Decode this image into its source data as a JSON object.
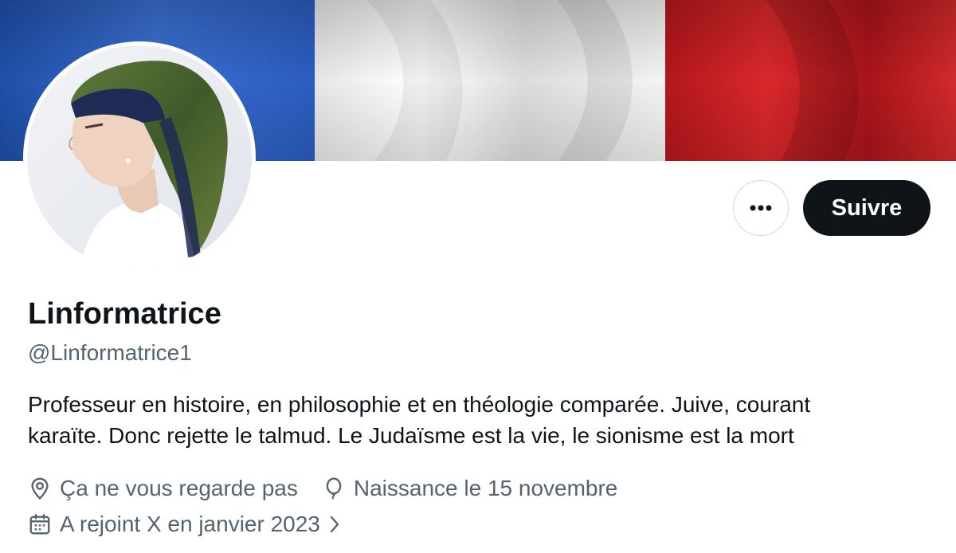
{
  "profile": {
    "display_name": "Linformatrice",
    "handle": "@Linformatrice1",
    "bio_line1": "Professeur en histoire, en philosophie et en théologie comparée. Juive, courant",
    "bio_line2": "karaïte. Donc rejette le talmud. Le Judaïsme est la vie, le sionisme est la mort",
    "location": "Ça ne vous regarde pas",
    "birthday": "Naissance le 15 novembre",
    "joined": "A rejoint X en janvier 2023"
  },
  "actions": {
    "more_icon": "more-horizontal-icon",
    "follow_label": "Suivre"
  },
  "icons": {
    "location": "location-pin-icon",
    "birthday": "balloon-icon",
    "joined": "calendar-icon",
    "joined_chevron": "chevron-right-icon"
  },
  "colors": {
    "text_primary": "#0f1419",
    "text_secondary": "#536471",
    "follow_button_bg": "#0f1419",
    "flag_blue": "#2f5fc0",
    "flag_white": "#f2f2f2",
    "flag_red": "#d1262a"
  }
}
